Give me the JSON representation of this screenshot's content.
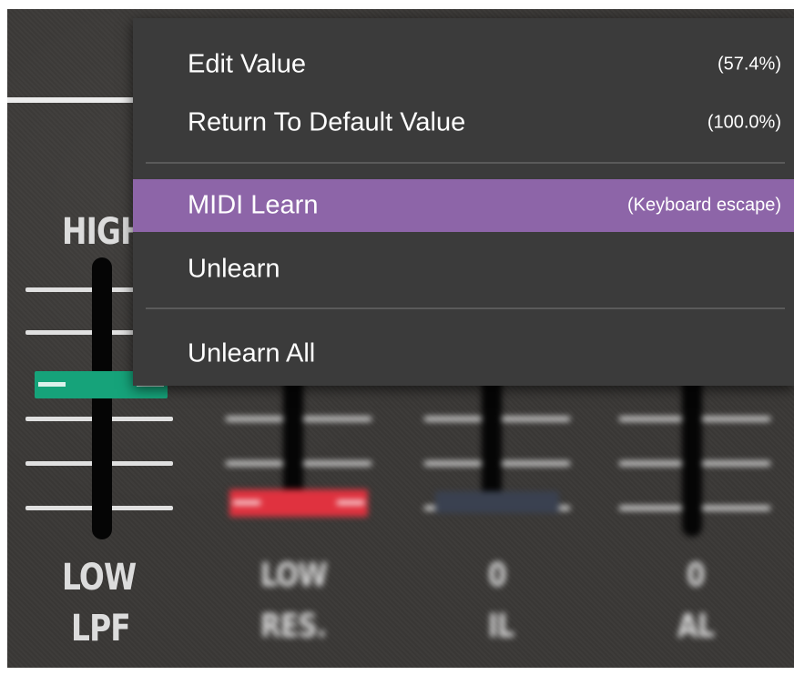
{
  "sliders": {
    "lpf": {
      "top_label": "HIGH",
      "bottom_label": "LOW",
      "name": "LPF"
    },
    "res": {
      "bottom_label": "LOW",
      "name": "RES."
    },
    "third": {
      "bottom_label": "0",
      "name": "IL"
    },
    "fourth": {
      "bottom_label": "0",
      "name": "AL"
    }
  },
  "menu": {
    "items": [
      {
        "label": "Edit Value",
        "shortcut": "(57.4%)"
      },
      {
        "label": "Return To Default Value",
        "shortcut": "(100.0%)"
      },
      {
        "label": "MIDI Learn",
        "shortcut": "(Keyboard escape)"
      },
      {
        "label": "Unlearn",
        "shortcut": ""
      },
      {
        "label": "Unlearn All",
        "shortcut": ""
      }
    ],
    "highlighted_item": "MIDI Learn",
    "highlight_color": "#8d65a8"
  },
  "colors": {
    "lpf_cap": "#16a37a",
    "res_cap": "#e0323f",
    "third_cap": "#3a4150"
  }
}
